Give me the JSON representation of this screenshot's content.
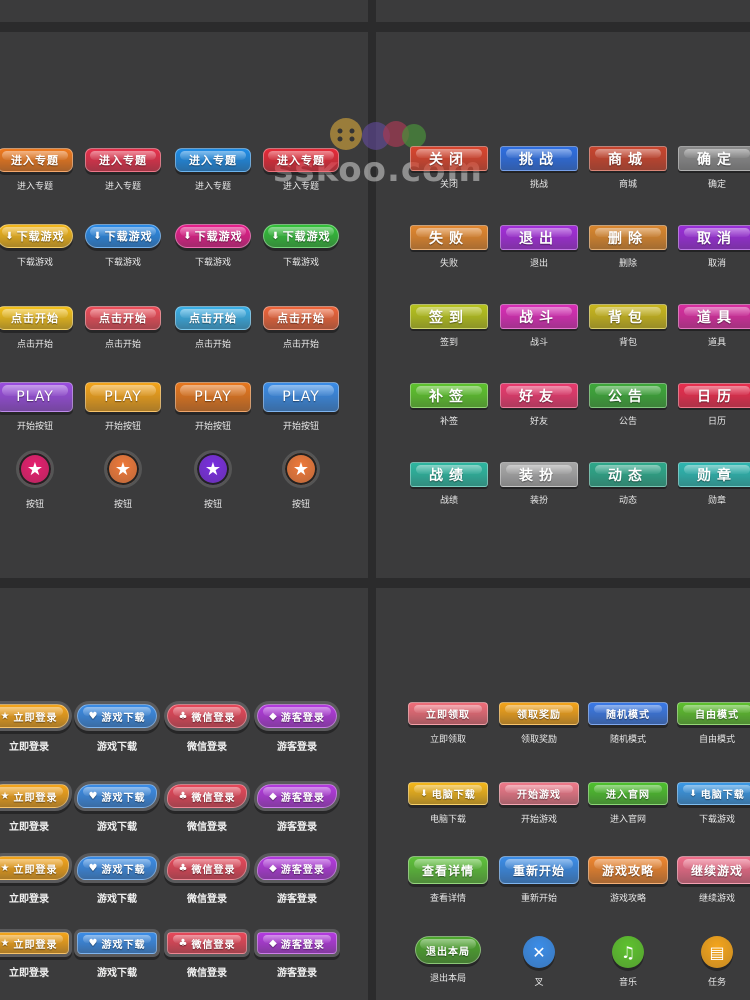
{
  "watermark": {
    "text": "sskoo.com"
  },
  "top_left": {
    "rows": [
      {
        "style": "rect",
        "items": [
          {
            "label": "进入专题",
            "caption": "进入专题",
            "color": "#f07a1e"
          },
          {
            "label": "进入专题",
            "caption": "进入专题",
            "color": "#e8314c"
          },
          {
            "label": "进入专题",
            "caption": "进入专题",
            "color": "#1e8de8"
          },
          {
            "label": "进入专题",
            "caption": "进入专题",
            "color": "#e82a38"
          }
        ]
      },
      {
        "style": "pill",
        "items": [
          {
            "label": "下载游戏",
            "caption": "下载游戏",
            "color": "#f5b81b",
            "icon": "download-icon"
          },
          {
            "label": "下载游戏",
            "caption": "下载游戏",
            "color": "#2b8be8",
            "icon": "download-icon"
          },
          {
            "label": "下载游戏",
            "caption": "下载游戏",
            "color": "#e81e8c",
            "icon": "download-icon"
          },
          {
            "label": "下载游戏",
            "caption": "下载游戏",
            "color": "#33c23a",
            "icon": "download-icon"
          }
        ]
      },
      {
        "style": "rect",
        "items": [
          {
            "label": "点击开始",
            "caption": "点击开始",
            "color": "#f5c21b"
          },
          {
            "label": "点击开始",
            "caption": "点击开始",
            "color": "#ee4e5a"
          },
          {
            "label": "点击开始",
            "caption": "点击开始",
            "color": "#3bb0e8"
          },
          {
            "label": "点击开始",
            "caption": "点击开始",
            "color": "#f0653a"
          }
        ]
      },
      {
        "style": "play",
        "items": [
          {
            "label": "PLAY",
            "caption": "开始按钮",
            "color": "#9b4ee0"
          },
          {
            "label": "PLAY",
            "caption": "开始按钮",
            "color": "#f5a51b"
          },
          {
            "label": "PLAY",
            "caption": "开始按钮",
            "color": "#e8781e"
          },
          {
            "label": "PLAY",
            "caption": "开始按钮",
            "color": "#3b8de8"
          }
        ]
      },
      {
        "style": "circle",
        "items": [
          {
            "label": "★",
            "caption": "按钮",
            "color": "#e81e6e",
            "icon": "star-icon"
          },
          {
            "label": "★",
            "caption": "按钮",
            "color": "#f07a3a",
            "icon": "star-icon"
          },
          {
            "label": "★",
            "caption": "按钮",
            "color": "#7a2ee0",
            "icon": "star-icon"
          },
          {
            "label": "★",
            "caption": "按钮",
            "color": "#f07a3a",
            "icon": "star-icon"
          }
        ]
      }
    ]
  },
  "top_right": {
    "rows": [
      [
        {
          "label": "关闭",
          "caption": "关闭",
          "color": "#d8452e"
        },
        {
          "label": "挑战",
          "caption": "挑战",
          "color": "#2e6ee0"
        },
        {
          "label": "商城",
          "caption": "商城",
          "color": "#c8452e"
        },
        {
          "label": "确定",
          "caption": "确定",
          "color": "#8a8a8a"
        }
      ],
      [
        {
          "label": "失败",
          "caption": "失败",
          "color": "#e0862e"
        },
        {
          "label": "退出",
          "caption": "退出",
          "color": "#a22ed8"
        },
        {
          "label": "删除",
          "caption": "删除",
          "color": "#d8862e"
        },
        {
          "label": "取消",
          "caption": "取消",
          "color": "#9a2ed8"
        }
      ],
      [
        {
          "label": "签到",
          "caption": "签到",
          "color": "#b6c21e"
        },
        {
          "label": "战斗",
          "caption": "战斗",
          "color": "#d82eb6"
        },
        {
          "label": "背包",
          "caption": "背包",
          "color": "#c8b61e"
        },
        {
          "label": "道具",
          "caption": "道具",
          "color": "#d82ea0"
        }
      ],
      [
        {
          "label": "补签",
          "caption": "补签",
          "color": "#5ec22e"
        },
        {
          "label": "好友",
          "caption": "好友",
          "color": "#e83a6e"
        },
        {
          "label": "公告",
          "caption": "公告",
          "color": "#3ea83a"
        },
        {
          "label": "日历",
          "caption": "日历",
          "color": "#e82e4e"
        }
      ],
      [
        {
          "label": "战绩",
          "caption": "战绩",
          "color": "#2eb6a0"
        },
        {
          "label": "装扮",
          "caption": "装扮",
          "color": "#a8a8a8"
        },
        {
          "label": "动态",
          "caption": "动态",
          "color": "#2ea88a"
        },
        {
          "label": "勋章",
          "caption": "勋章",
          "color": "#2eb6b0"
        }
      ]
    ]
  },
  "bottom_left": {
    "rows": [
      {
        "style": "pill",
        "items": [
          {
            "label": "立即登录",
            "caption": "立即登录",
            "color": "#f5a51b",
            "icon": "star-icon"
          },
          {
            "label": "游戏下载",
            "caption": "游戏下载",
            "color": "#3b8de8",
            "icon": "heart-icon"
          },
          {
            "label": "微信登录",
            "caption": "微信登录",
            "color": "#e8485a",
            "icon": "club-icon"
          },
          {
            "label": "游客登录",
            "caption": "游客登录",
            "color": "#b43ae0",
            "icon": "diamond-icon"
          }
        ]
      },
      {
        "style": "wave",
        "items": [
          {
            "label": "立即登录",
            "caption": "立即登录",
            "color": "#f5a51b",
            "icon": "star-icon"
          },
          {
            "label": "游戏下载",
            "caption": "游戏下载",
            "color": "#3b8de8",
            "icon": "heart-icon"
          },
          {
            "label": "微信登录",
            "caption": "微信登录",
            "color": "#e8485a",
            "icon": "club-icon"
          },
          {
            "label": "游客登录",
            "caption": "游客登录",
            "color": "#b43ae0",
            "icon": "diamond-icon"
          }
        ]
      },
      {
        "style": "wave",
        "items": [
          {
            "label": "立即登录",
            "caption": "立即登录",
            "color": "#f5a51b",
            "icon": "star-icon"
          },
          {
            "label": "游戏下载",
            "caption": "游戏下载",
            "color": "#3b8de8",
            "icon": "heart-icon"
          },
          {
            "label": "微信登录",
            "caption": "微信登录",
            "color": "#e8485a",
            "icon": "club-icon"
          },
          {
            "label": "游客登录",
            "caption": "游客登录",
            "color": "#b43ae0",
            "icon": "diamond-icon"
          }
        ]
      },
      {
        "style": "sq",
        "items": [
          {
            "label": "立即登录",
            "caption": "立即登录",
            "color": "#f5a51b",
            "icon": "star-icon"
          },
          {
            "label": "游戏下载",
            "caption": "游戏下载",
            "color": "#3b8de8",
            "icon": "heart-icon"
          },
          {
            "label": "微信登录",
            "caption": "微信登录",
            "color": "#e8485a",
            "icon": "club-icon"
          },
          {
            "label": "游客登录",
            "caption": "游客登录",
            "color": "#b43ae0",
            "icon": "diamond-icon"
          }
        ]
      }
    ]
  },
  "bottom_right": {
    "rows": [
      {
        "style": "flat",
        "items": [
          {
            "label": "立即领取",
            "caption": "立即领取",
            "color": "#f06e7a"
          },
          {
            "label": "领取奖励",
            "caption": "领取奖励",
            "color": "#f5a51b"
          },
          {
            "label": "随机模式",
            "caption": "随机模式",
            "color": "#3b7ae8"
          },
          {
            "label": "自由模式",
            "caption": "自由模式",
            "color": "#5ec22e"
          }
        ]
      },
      {
        "style": "flat",
        "items": [
          {
            "label": "电脑下载",
            "caption": "电脑下载",
            "color": "#f5b81b",
            "icon": "download-icon"
          },
          {
            "label": "开始游戏",
            "caption": "开始游戏",
            "color": "#f07a8a"
          },
          {
            "label": "进入官网",
            "caption": "进入官网",
            "color": "#4ec22e"
          },
          {
            "label": "电脑下载",
            "caption": "下载游戏",
            "color": "#3b9ae8",
            "icon": "download-icon"
          }
        ]
      },
      {
        "style": "tall",
        "items": [
          {
            "label": "查看详情",
            "caption": "查看详情",
            "color": "#5ec23a"
          },
          {
            "label": "重新开始",
            "caption": "重新开始",
            "color": "#3b8de8"
          },
          {
            "label": "游戏攻略",
            "caption": "游戏攻略",
            "color": "#f0862e"
          },
          {
            "label": "继续游戏",
            "caption": "继续游戏",
            "color": "#f06e8a"
          }
        ]
      },
      {
        "style": "mixed",
        "items": [
          {
            "label": "退出本局",
            "caption": "退出本局",
            "color": "#4ea82e"
          },
          {
            "label": "✕",
            "caption": "叉",
            "color": "#3b8de8",
            "icon": "close-icon"
          },
          {
            "label": "♫",
            "caption": "音乐",
            "color": "#5ec22e",
            "icon": "music-icon"
          },
          {
            "label": "▤",
            "caption": "任务",
            "color": "#f5a51b",
            "icon": "clipboard-icon"
          }
        ]
      }
    ]
  }
}
